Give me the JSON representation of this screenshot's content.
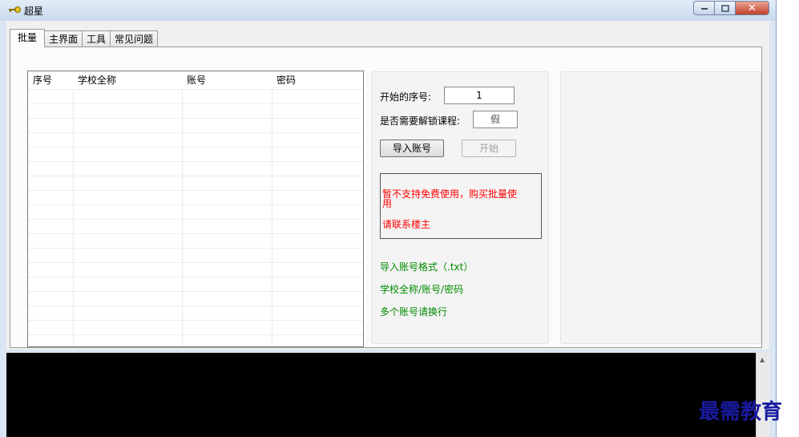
{
  "window": {
    "title": "超星"
  },
  "tabs": [
    "批量",
    "主界面",
    "工具",
    "常见问题"
  ],
  "table": {
    "columns": [
      "序号",
      "学校全称",
      "账号",
      "密码"
    ],
    "rows": []
  },
  "form": {
    "start_label": "开始的序号:",
    "start_value": "1",
    "unlock_label": "是否需要解锁课程:",
    "unlock_value": "假",
    "import_button": "导入账号",
    "start_button": "开始"
  },
  "notice": {
    "line1": "暂不支持免费使用，购买批量使",
    "line1b": "用",
    "line2": "请联系楼主"
  },
  "hints": [
    "导入账号格式（.txt）",
    "学校全称/账号/密码",
    "多个账号请换行"
  ],
  "watermark": "最需教育",
  "colors": {
    "notice_text": "#ff0000",
    "hint_text": "#008a00",
    "console_bg": "#000000"
  }
}
